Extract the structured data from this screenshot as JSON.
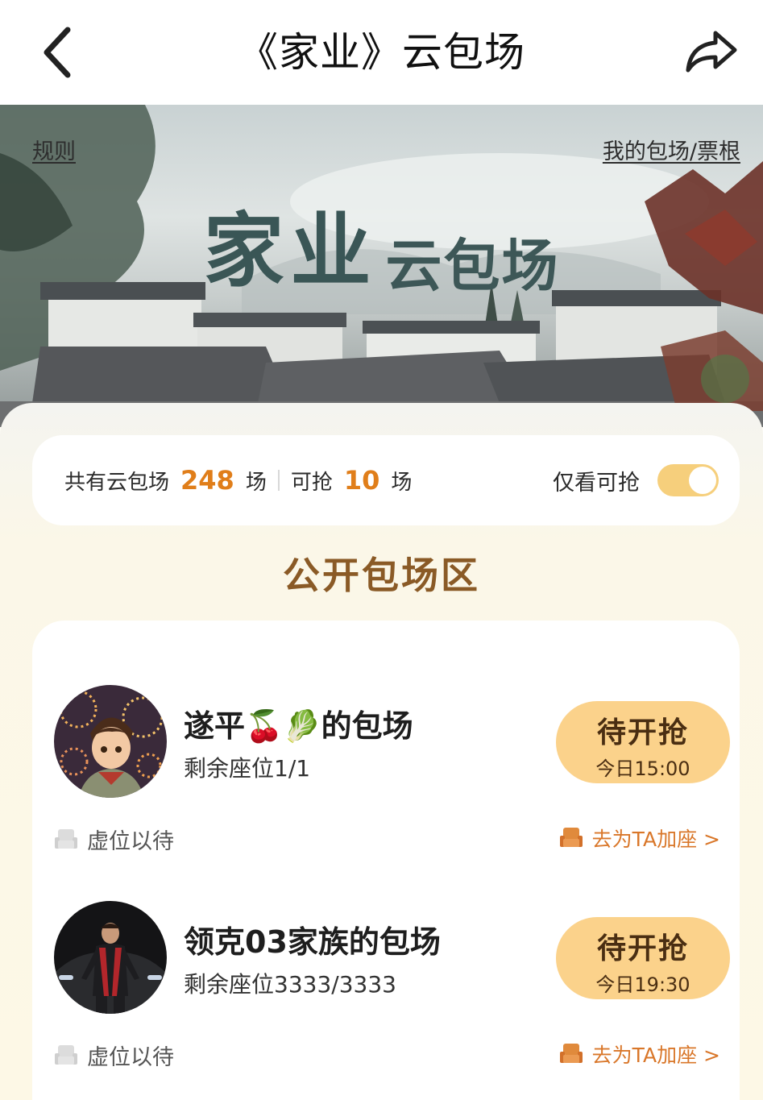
{
  "nav": {
    "title": "《家业》云包场",
    "back_icon": "chevron-left-icon",
    "share_icon": "share-arrow-icon"
  },
  "banner": {
    "rules_link": "规则",
    "my_link": "我的包场/票根",
    "title_big": "家业",
    "title_small": "云包场"
  },
  "stats": {
    "total_prefix": "共有云包场",
    "total_count": "248",
    "total_suffix": "场",
    "available_prefix": "可抢",
    "available_count": "10",
    "available_suffix": "场",
    "filter_label": "仅看可抢",
    "filter_on": true
  },
  "section": {
    "title": "公开包场区"
  },
  "sessions": [
    {
      "name": "遂平🍒🥬的包场",
      "seats": "剩余座位1/1",
      "button_label": "待开抢",
      "button_time": "今日15:00",
      "empty_seat_label": "虚位以待",
      "add_seat_label": "去为TA加座 >"
    },
    {
      "name": "领克03家族的包场",
      "seats": "剩余座位3333/3333",
      "button_label": "待开抢",
      "button_time": "今日19:30",
      "empty_seat_label": "虚位以待",
      "add_seat_label": "去为TA加座 >"
    }
  ],
  "colors": {
    "accent": "#e07e1a",
    "button_bg": "#fbd28b",
    "section_title": "#8a5a26",
    "link_orange": "#d9772a"
  }
}
